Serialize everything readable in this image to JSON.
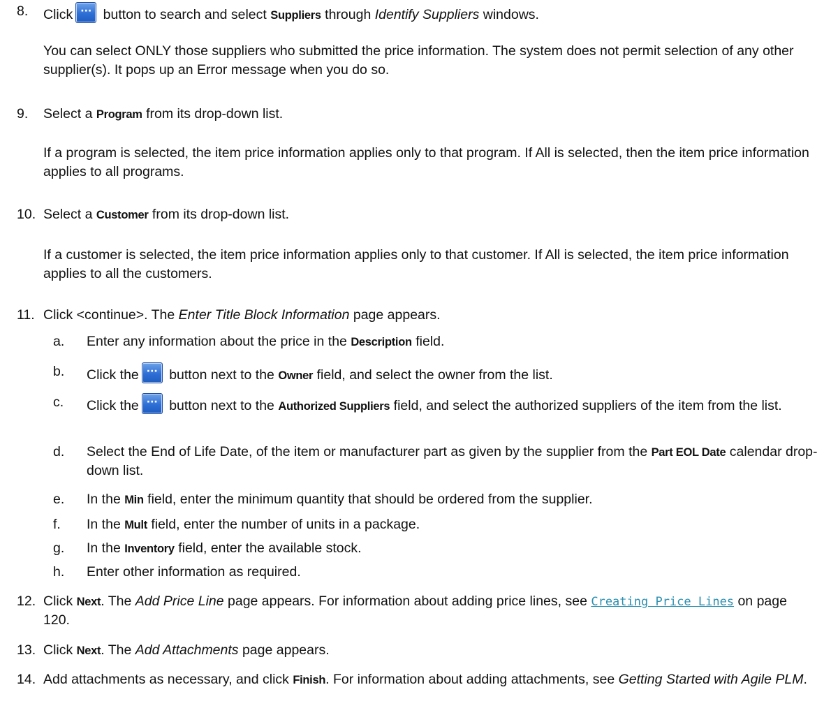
{
  "steps": {
    "s8": {
      "num": "8.",
      "pre": "Click",
      "mid": " button to search and select ",
      "b1": "Suppliers",
      "mid2": " through ",
      "i1": "Identify Suppliers",
      "post": " windows.",
      "note": "You can select ONLY those suppliers who submitted the price information. The system does not permit selection of any other supplier(s). It pops up an Error message when you do so."
    },
    "s9": {
      "num": "9.",
      "pre": "Select a ",
      "b1": "Program",
      "post": " from its drop-down list.",
      "note": "If a program is selected, the item price information applies only to that program. If All is selected, then the item price information applies to all programs."
    },
    "s10": {
      "num": "10.",
      "pre": "Select a ",
      "b1": "Customer",
      "post": " from its drop-down list.",
      "note": "If a customer is selected, the item price information applies only to that customer. If All is selected, the item price information applies to all the customers."
    },
    "s11": {
      "num": "11.",
      "pre": "Click <continue>. The ",
      "i1": "Enter Title Block Information",
      "post": " page appears.",
      "subs": {
        "a": {
          "label": "a.",
          "pre": "Enter any information about the price in the ",
          "b1": "Description",
          "post": " field."
        },
        "b": {
          "label": "b.",
          "pre": "Click the",
          "mid": " button next to the ",
          "b1": "Owner",
          "post": " field, and select the owner from the list."
        },
        "c": {
          "label": "c.",
          "pre": "Click the",
          "mid": " button next to the ",
          "b1": "Authorized Suppliers",
          "post": " field, and select the authorized suppliers of the item from the list."
        },
        "d": {
          "label": "d.",
          "pre": "Select the End of Life Date, of the item or manufacturer part as given by the supplier from the ",
          "b1": "Part EOL Date",
          "post": " calendar drop-down list."
        },
        "e": {
          "label": "e.",
          "pre": "In the ",
          "b1": "Min",
          "post": " field, enter the minimum quantity that should be ordered from the supplier."
        },
        "f": {
          "label": "f.",
          "pre": "In the ",
          "b1": "Mult",
          "post": " field, enter the number of units in a package."
        },
        "g": {
          "label": "g.",
          "pre": "In the ",
          "b1": "Inventory",
          "post": " field, enter the available stock."
        },
        "h": {
          "label": "h.",
          "text": "Enter other information as required."
        }
      }
    },
    "s12": {
      "num": "12.",
      "pre": "Click ",
      "b1": "Next",
      "mid": ". The ",
      "i1": "Add Price Line",
      "mid2": " page appears. For information about adding price lines, see ",
      "link": "Creating Price Lines",
      "post": " on page 120."
    },
    "s13": {
      "num": "13.",
      "pre": "Click ",
      "b1": "Next",
      "mid": ". The ",
      "i1": "Add Attachments",
      "post": " page appears."
    },
    "s14": {
      "num": "14.",
      "pre": "Add attachments as necessary, and click ",
      "b1": "Finish",
      "mid": ". For information about adding attachments, see ",
      "i1": "Getting Started with Agile PLM",
      "post": "."
    }
  }
}
